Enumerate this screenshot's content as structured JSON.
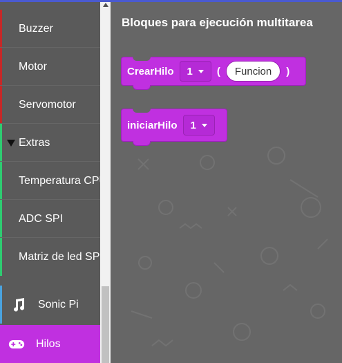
{
  "sidebar": {
    "items": [
      {
        "label": "Buzzer",
        "strip": "#c62828"
      },
      {
        "label": "Motor",
        "strip": "#c62828"
      },
      {
        "label": "Servomotor",
        "strip": "#c62828"
      },
      {
        "label": "Extras",
        "strip": "#2ecc71"
      },
      {
        "label": "Temperatura CPU",
        "strip": "#2ecc71"
      },
      {
        "label": "ADC SPI",
        "strip": "#2ecc71"
      },
      {
        "label": "Matriz de led SPI",
        "strip": "#2ecc71"
      }
    ],
    "categories": [
      {
        "label": "Sonic Pi",
        "icon": "music-note-icon"
      },
      {
        "label": "Hilos",
        "icon": "gamepad-icon",
        "selected": true
      }
    ]
  },
  "flyout": {
    "title": "Bloques para ejecución multitarea",
    "blocks": [
      {
        "label": "CrearHilo",
        "dropdown": "1",
        "open_paren": "(",
        "input": "Funcion",
        "close_paren": ")"
      },
      {
        "label": "iniciarHilo",
        "dropdown": "1"
      }
    ]
  },
  "colors": {
    "accent": "#c030e0",
    "workspace": "#666666",
    "sidebar": "#5a5a5a"
  }
}
